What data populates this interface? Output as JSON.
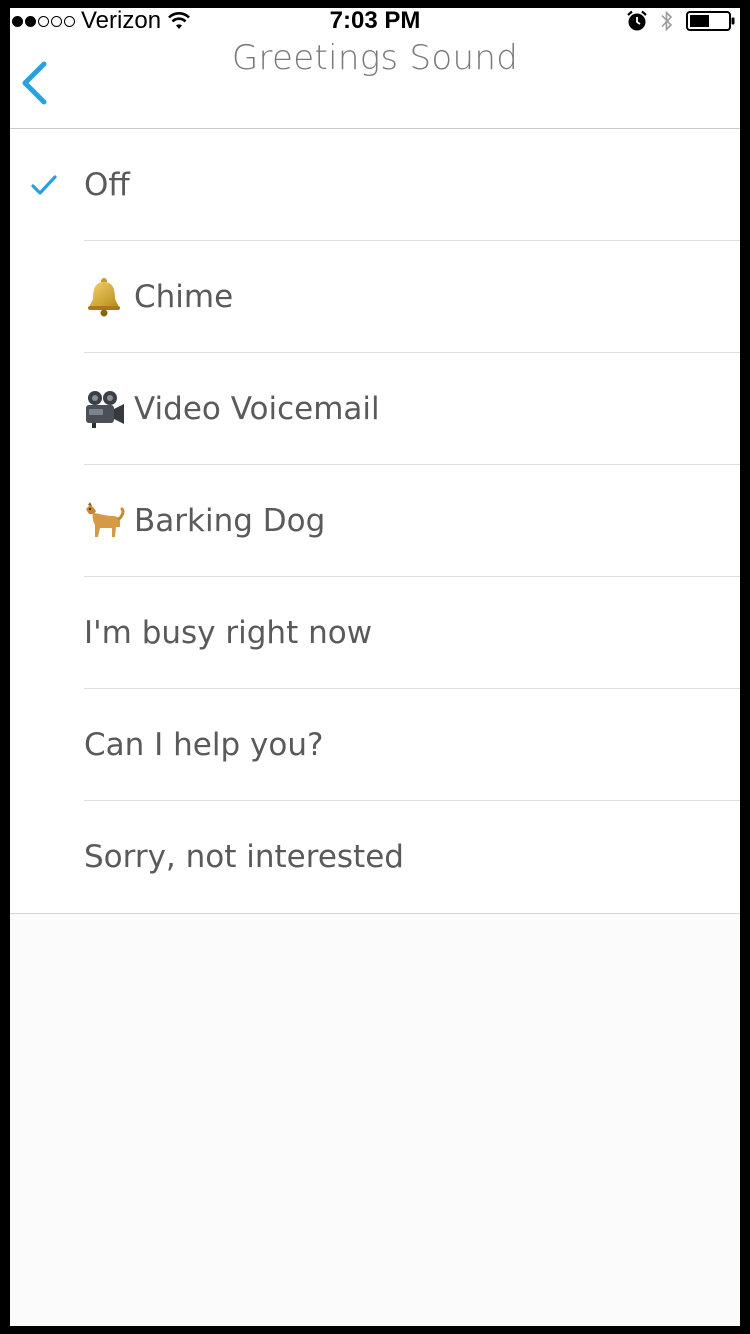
{
  "status_bar": {
    "carrier": "Verizon",
    "time": "7:03 PM",
    "signal_bars": 2
  },
  "nav": {
    "title": "Greetings Sound"
  },
  "colors": {
    "accent": "#2aa0e0",
    "text": "#5a5a5a",
    "title": "#7a7a7a"
  },
  "sounds": [
    {
      "label": "Off",
      "icon": "",
      "selected": true
    },
    {
      "label": "Chime",
      "icon": "bell-icon",
      "selected": false
    },
    {
      "label": "Video Voicemail",
      "icon": "movie-camera-icon",
      "selected": false
    },
    {
      "label": "Barking Dog",
      "icon": "dog-icon",
      "selected": false
    },
    {
      "label": "I'm busy right now",
      "icon": "",
      "selected": false
    },
    {
      "label": "Can I help you?",
      "icon": "",
      "selected": false
    },
    {
      "label": "Sorry, not interested",
      "icon": "",
      "selected": false
    }
  ]
}
